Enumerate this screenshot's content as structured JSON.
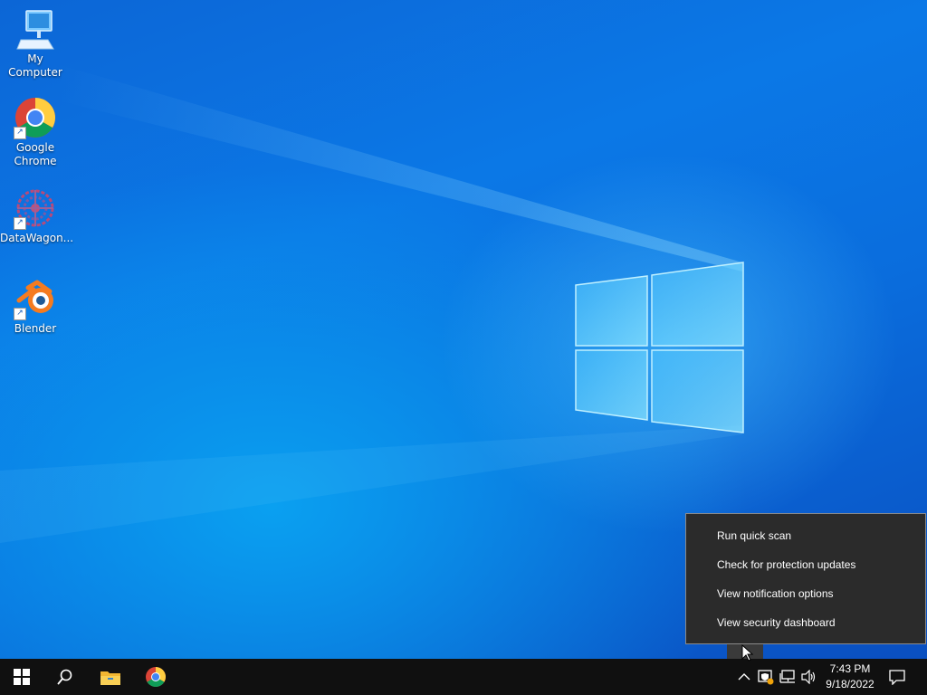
{
  "desktop": {
    "icons": [
      {
        "label": "My Computer",
        "icon": "computer-icon"
      },
      {
        "label": "Google Chrome",
        "icon": "chrome-icon"
      },
      {
        "label": "DataWagon...",
        "icon": "datawagon-icon"
      },
      {
        "label": "Blender",
        "icon": "blender-icon"
      }
    ]
  },
  "context_menu": {
    "items": [
      {
        "label": "Run quick scan"
      },
      {
        "label": "Check for protection updates"
      },
      {
        "label": "View notification options"
      },
      {
        "label": "View security dashboard"
      }
    ]
  },
  "taskbar": {
    "buttons": [
      "start-icon",
      "search-icon",
      "file-explorer-icon",
      "chrome-icon"
    ],
    "tray": [
      "chevron-up-icon",
      "windows-security-icon",
      "network-icon",
      "volume-icon"
    ],
    "clock": {
      "time": "7:43 PM",
      "date": "9/18/2022"
    },
    "notification": "action-center-icon"
  },
  "colors": {
    "taskbar_bg": "#101010",
    "menu_bg": "#2b2b2b",
    "wallpaper_blue": "#0b78e6"
  }
}
